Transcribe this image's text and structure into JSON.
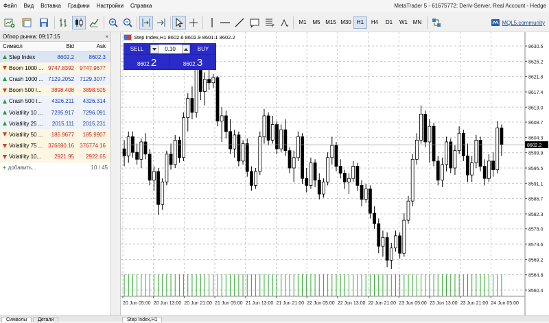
{
  "window": {
    "title": "MetaTrader 5 - 61675772: Deriv-Server, Real Account - Hedge"
  },
  "menu": [
    "Файл",
    "Вид",
    "Вставка",
    "Графики",
    "Настройки",
    "Справка"
  ],
  "toolbar": {
    "timeframes": [
      "M1",
      "M5",
      "M15",
      "M30",
      "H1",
      "H4",
      "D1",
      "W1",
      "MN"
    ],
    "active_timeframe": "H1",
    "mql_link": "MQL5.community"
  },
  "market_watch": {
    "title": "Обзор рынка: 09:17:15",
    "close_glyph": "×",
    "headers": {
      "symbol": "Символ",
      "bid": "Bid",
      "ask": "Ask"
    },
    "rows": [
      {
        "symbol": "Step Index",
        "bid": "8602.2",
        "ask": "8602.3",
        "dir": "up",
        "selected": true
      },
      {
        "symbol": "Boom 1000 ...",
        "bid": "9747.8392",
        "ask": "9747.9677",
        "dir": "down"
      },
      {
        "symbol": "Crash 1000 ...",
        "bid": "7129.2052",
        "ask": "7129.3077",
        "dir": "up"
      },
      {
        "symbol": "Boom 500 I...",
        "bid": "3898.408",
        "ask": "3898.505",
        "dir": "down"
      },
      {
        "symbol": "Crash 500 I...",
        "bid": "4326.211",
        "ask": "4326.314",
        "dir": "up"
      },
      {
        "symbol": "Volatility 10 ...",
        "bid": "7295.917",
        "ask": "7296.091",
        "dir": "up"
      },
      {
        "symbol": "Volatility 25 ...",
        "bid": "2015.111",
        "ask": "2015.231",
        "dir": "up"
      },
      {
        "symbol": "Volatility 50 ...",
        "bid": "185.9677",
        "ask": "185.9907",
        "dir": "down"
      },
      {
        "symbol": "Volatility 75 ...",
        "bid": "376690.16",
        "ask": "376774.16",
        "dir": "down"
      },
      {
        "symbol": "Volatility 10...",
        "bid": "2921.95",
        "ask": "2922.65",
        "dir": "down"
      }
    ],
    "add_label": "добавить...",
    "count": "10 / 45",
    "tabs": [
      "Символы",
      "Детали"
    ]
  },
  "chart": {
    "header": "Step Index,H1  8602.6 8602.9 8601.1 8602.2",
    "sell_label": "SELL",
    "buy_label": "BUY",
    "volume": "0.10",
    "sell_price_small": "8602.",
    "sell_price_big": "2",
    "buy_price_small": "8602.",
    "buy_price_big": "3",
    "current_price": "8602.2",
    "tab_label": "Step Index,H1",
    "colors": {
      "bull": "#ffffff",
      "bear": "#000000",
      "volume": "#2fa82f",
      "grid": "#c8c8c8"
    }
  },
  "chart_data": {
    "type": "candlestick",
    "y_ticks": [
      "8630.6",
      "8626.2",
      "8621.8",
      "8617.4",
      "8613.0",
      "8608.7",
      "8604.3",
      "8599.9",
      "8595.5",
      "8591.1",
      "8586.7",
      "8582.3",
      "8578.0",
      "8573.6",
      "8569.2",
      "8564.8",
      "8560.4"
    ],
    "x_ticks": [
      "20 Jun 05:00",
      "20 Jun 13:00",
      "20 Jun 21:00",
      "21 Jun 05:00",
      "21 Jun 13:00",
      "21 Jun 21:00",
      "22 Jun 05:00",
      "22 Jun 13:00",
      "22 Jun 21:00",
      "23 Jun 05:00",
      "23 Jun 13:00",
      "23 Jun 21:00",
      "24 Jun 05:00"
    ],
    "ylim": [
      8558.5,
      8633.0
    ],
    "candles": [
      [
        8601.0,
        8603.5,
        8596.0,
        8599.0
      ],
      [
        8599.0,
        8606.0,
        8597.0,
        8604.5
      ],
      [
        8604.5,
        8606.0,
        8598.5,
        8600.0
      ],
      [
        8600.0,
        8602.5,
        8596.5,
        8598.0
      ],
      [
        8598.0,
        8604.0,
        8595.5,
        8603.0
      ],
      [
        8603.0,
        8605.5,
        8598.0,
        8599.5
      ],
      [
        8599.5,
        8601.0,
        8590.5,
        8592.0
      ],
      [
        8592.0,
        8596.0,
        8589.0,
        8594.5
      ],
      [
        8594.5,
        8595.5,
        8582.0,
        8585.0
      ],
      [
        8585.0,
        8592.5,
        8583.5,
        8591.5
      ],
      [
        8591.5,
        8600.5,
        8590.5,
        8599.5
      ],
      [
        8599.5,
        8602.5,
        8595.0,
        8596.5
      ],
      [
        8596.5,
        8605.0,
        8595.5,
        8603.5
      ],
      [
        8603.5,
        8604.5,
        8597.0,
        8598.5
      ],
      [
        8598.5,
        8611.5,
        8597.5,
        8610.0
      ],
      [
        8610.0,
        8617.0,
        8606.0,
        8615.5
      ],
      [
        8615.5,
        8619.0,
        8609.5,
        8611.5
      ],
      [
        8611.5,
        8625.5,
        8610.0,
        8624.0
      ],
      [
        8624.0,
        8629.0,
        8615.0,
        8617.5
      ],
      [
        8617.5,
        8623.0,
        8613.5,
        8621.0
      ],
      [
        8621.0,
        8626.5,
        8618.0,
        8620.0
      ],
      [
        8620.0,
        8622.5,
        8618.5,
        8621.5
      ],
      [
        8621.5,
        8622.0,
        8607.5,
        8609.0
      ],
      [
        8609.0,
        8613.0,
        8603.0,
        8610.5
      ],
      [
        8610.5,
        8612.0,
        8604.0,
        8606.0
      ],
      [
        8606.0,
        8609.5,
        8599.5,
        8601.0
      ],
      [
        8601.0,
        8606.5,
        8598.5,
        8605.0
      ],
      [
        8605.0,
        8606.0,
        8596.0,
        8597.5
      ],
      [
        8597.5,
        8603.5,
        8596.5,
        8602.5
      ],
      [
        8602.5,
        8604.0,
        8593.0,
        8594.5
      ],
      [
        8594.5,
        8596.0,
        8589.0,
        8590.5
      ],
      [
        8590.5,
        8595.5,
        8589.5,
        8594.5
      ],
      [
        8594.5,
        8606.0,
        8593.5,
        8604.5
      ],
      [
        8604.5,
        8612.5,
        8602.5,
        8610.5
      ],
      [
        8610.5,
        8611.5,
        8602.0,
        8603.5
      ],
      [
        8603.5,
        8610.5,
        8602.5,
        8608.0
      ],
      [
        8608.0,
        8609.0,
        8599.5,
        8601.0
      ],
      [
        8601.0,
        8608.0,
        8600.0,
        8606.5
      ],
      [
        8606.5,
        8609.5,
        8599.0,
        8600.5
      ],
      [
        8600.5,
        8601.5,
        8594.0,
        8595.5
      ],
      [
        8595.5,
        8600.5,
        8591.5,
        8598.5
      ],
      [
        8598.5,
        8606.0,
        8597.5,
        8604.5
      ],
      [
        8604.5,
        8605.5,
        8591.0,
        8592.5
      ],
      [
        8592.5,
        8595.5,
        8588.5,
        8590.5
      ],
      [
        8590.5,
        8598.5,
        8589.5,
        8597.0
      ],
      [
        8597.0,
        8598.0,
        8590.0,
        8592.0
      ],
      [
        8592.0,
        8594.0,
        8586.5,
        8588.0
      ],
      [
        8588.0,
        8592.5,
        8587.0,
        8591.5
      ],
      [
        8591.5,
        8600.0,
        8590.5,
        8598.5
      ],
      [
        8598.5,
        8604.5,
        8596.5,
        8602.0
      ],
      [
        8602.0,
        8603.0,
        8594.5,
        8596.0
      ],
      [
        8596.0,
        8598.0,
        8592.5,
        8594.0
      ],
      [
        8594.0,
        8595.0,
        8589.5,
        8591.5
      ],
      [
        8591.5,
        8594.0,
        8588.0,
        8592.5
      ],
      [
        8592.5,
        8597.5,
        8591.5,
        8596.0
      ],
      [
        8596.0,
        8597.0,
        8589.0,
        8590.5
      ],
      [
        8590.5,
        8592.0,
        8584.5,
        8586.5
      ],
      [
        8586.5,
        8591.0,
        8585.5,
        8589.5
      ],
      [
        8589.5,
        8590.5,
        8581.0,
        8582.5
      ],
      [
        8582.5,
        8584.5,
        8578.0,
        8579.5
      ],
      [
        8579.5,
        8581.0,
        8571.0,
        8573.0
      ],
      [
        8573.0,
        8577.5,
        8570.0,
        8575.5
      ],
      [
        8575.5,
        8577.0,
        8567.0,
        8569.0
      ],
      [
        8569.0,
        8574.0,
        8566.5,
        8572.5
      ],
      [
        8572.5,
        8577.5,
        8571.5,
        8576.0
      ],
      [
        8576.0,
        8577.0,
        8569.5,
        8571.0
      ],
      [
        8571.0,
        8582.5,
        8570.0,
        8580.5
      ],
      [
        8580.5,
        8587.5,
        8579.5,
        8586.0
      ],
      [
        8586.0,
        8599.5,
        8584.5,
        8598.0
      ],
      [
        8598.0,
        8605.5,
        8596.5,
        8603.5
      ],
      [
        8603.5,
        8613.5,
        8602.5,
        8611.0
      ],
      [
        8611.0,
        8612.0,
        8601.5,
        8603.0
      ],
      [
        8603.0,
        8609.5,
        8597.0,
        8607.5
      ],
      [
        8607.5,
        8608.5,
        8596.0,
        8597.5
      ],
      [
        8597.5,
        8599.0,
        8590.5,
        8592.0
      ],
      [
        8592.0,
        8598.5,
        8590.0,
        8596.5
      ],
      [
        8596.5,
        8604.5,
        8594.5,
        8603.0
      ],
      [
        8603.0,
        8604.0,
        8594.0,
        8595.5
      ],
      [
        8595.5,
        8602.0,
        8593.5,
        8600.5
      ],
      [
        8600.5,
        8607.5,
        8599.5,
        8605.5
      ],
      [
        8605.5,
        8606.5,
        8597.5,
        8599.0
      ],
      [
        8599.0,
        8602.5,
        8591.5,
        8593.5
      ],
      [
        8593.5,
        8599.0,
        8591.5,
        8597.0
      ],
      [
        8597.0,
        8605.0,
        8595.5,
        8603.5
      ],
      [
        8603.5,
        8604.5,
        8594.5,
        8596.0
      ],
      [
        8596.0,
        8598.0,
        8590.5,
        8592.5
      ],
      [
        8592.5,
        8599.5,
        8591.5,
        8597.5
      ],
      [
        8597.5,
        8600.0,
        8593.0,
        8595.0
      ],
      [
        8595.0,
        8609.0,
        8594.0,
        8607.0
      ],
      [
        8607.0,
        8608.0,
        8599.0,
        8602.2
      ]
    ]
  }
}
